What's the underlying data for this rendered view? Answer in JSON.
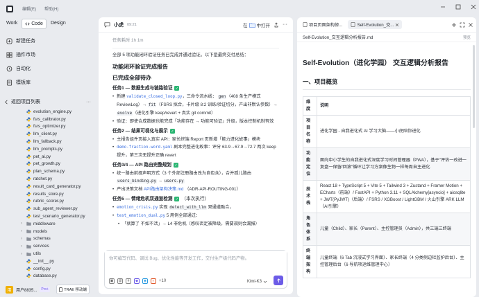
{
  "titlebar": {
    "menus": [
      "编辑(E)",
      "帮助(H)"
    ]
  },
  "sidebar": {
    "modes": [
      "Work",
      "Code",
      "Design"
    ],
    "nav": [
      {
        "label": "新建任务",
        "icon": "new-task-icon"
      },
      {
        "label": "插件市场",
        "icon": "plugin-market-icon"
      },
      {
        "label": "自动化",
        "icon": "automation-icon"
      },
      {
        "label": "模板库",
        "icon": "template-icon"
      }
    ],
    "back_label": "返回项目列表",
    "files": [
      {
        "name": "evolution_engine.py",
        "type": "file"
      },
      {
        "name": "fsrs_calibrator.py",
        "type": "file"
      },
      {
        "name": "fsrs_optimizer.py",
        "type": "file"
      },
      {
        "name": "llm_client.py",
        "type": "file"
      },
      {
        "name": "llm_fallback.py",
        "type": "file"
      },
      {
        "name": "llm_prompts.py",
        "type": "file"
      },
      {
        "name": "pet_ai.py",
        "type": "file"
      },
      {
        "name": "pet_growth.py",
        "type": "file"
      },
      {
        "name": "plan_schema.py",
        "type": "file"
      },
      {
        "name": "ratchet.py",
        "type": "file"
      },
      {
        "name": "result_card_generator.py",
        "type": "file"
      },
      {
        "name": "results_store.py",
        "type": "file"
      },
      {
        "name": "rubric_scorer.py",
        "type": "file"
      },
      {
        "name": "sub_agent_reviewer.py",
        "type": "file"
      },
      {
        "name": "test_scenario_generator.py",
        "type": "file"
      },
      {
        "name": "middleware",
        "type": "folder"
      },
      {
        "name": "models",
        "type": "folder"
      },
      {
        "name": "schemas",
        "type": "folder"
      },
      {
        "name": "services",
        "type": "folder"
      },
      {
        "name": "utils",
        "type": "folder"
      },
      {
        "name": "__init__.py",
        "type": "file"
      },
      {
        "name": "config.py",
        "type": "file"
      },
      {
        "name": "database.py",
        "type": "file"
      }
    ],
    "user": {
      "name": "用户8835...",
      "badge": "Pro+",
      "avatar": "用",
      "trae_label": "TRAE 移动端"
    }
  },
  "chat": {
    "title": "小虎",
    "time": "09:21",
    "branch_label": "在",
    "open_label": "中打开",
    "elapsed": "任务耗时 1h 1m",
    "intro": "全部 5 项功能闭环验证任务已完成并通过验证。以下是最终交付总结：",
    "h1": "功能闭环验证完成报告",
    "h1b": "已完成全部待办",
    "task1_title": "任务1 — 数据生成与链路验证",
    "task1_b1_pre": "新建",
    "task1_b1_code1": "validate_closed_loop.py",
    "task1_b1_mid": "，三命令流水线：",
    "task1_b1_code2": "gen",
    "task1_b1_mid2": "（408 条生产模式 ReviewLog）→",
    "task1_b1_code3": "fit",
    "task1_b1_mid3": "（FSRS 拟合，卡片级 8:2 训练/验证切分，产出非默认参数）→",
    "task1_b1_code4": "evolve",
    "task1_b1_post": "（进化引擎 keep/revert + 真实 git commit）",
    "task1_b2": "验证：即使合成数据也能完成「功能存在 → 功能可验证」升级，版本控制机制有效",
    "task2_title": "任务2 — 结果可视化与展示",
    "task2_b1": "主报告组件页接入真实 API：家长终端 Report 页新增「能力进化故事」模块",
    "task2_b2_code": "demo-fraction-word.yaml",
    "task2_b2_post": "剧本完整进化故事：评分 63.9→67.9→72.7 两次 keep 提升，第三次无提升正确 revert",
    "task3_title": "任务3/4 — API 路由完整规划",
    "task3_b1_pre": "统一路由前缀声明方式（3 个外部注册路由改为自包含），合并孤儿路由",
    "task3_b1_code1": "users_binding.py",
    "task3_b1_arrow": "→",
    "task3_b1_code2": "users.py",
    "task3_b2_pre": "产出决策文档",
    "task3_b2_link": "API路由架构决策.md",
    "task3_b2_post": "（ADR-API-ROUTING-001）",
    "task5_title": "任务5 — 情绪危机双通道检测",
    "task5_title_post": "（本次执行）",
    "task5_b1_code1": "emotion_crisis.py",
    "task5_b1_mid": "实现",
    "task5_b1_code2": "detect_with_llm",
    "task5_b1_post": "双通道融合，",
    "task5_b2_code": "test_emotion_dual.py",
    "task5_b2_post": "5 用例全部通过：",
    "task5_b3": "「就算了 不如不活」→ L4 非危机（感叹否定被降级，需要规则会漏报）",
    "composer_placeholder": "你可编写代码、调试 Bug、优化性能等开发工作，交付生产级代码产物。",
    "composer_count": "+10",
    "model": "Kimi-K3"
  },
  "doc": {
    "tabs": [
      {
        "label": "项目页面架构修..."
      },
      {
        "label": "Self-Evolution_交..."
      }
    ],
    "path": "Self-Evolution_交互逻辑分析报告.md",
    "mode_label": "预览",
    "h1": "Self-Evolution（进化学园） 交互逻辑分析报告",
    "h2": "一、项目概览",
    "table_headers": [
      "维度",
      "说明"
    ],
    "rows": [
      {
        "key": "项目名称",
        "value": "进化学园 - 自我进化式 AI 学习大脑——小虎陪你进化"
      },
      {
        "key": "功能定位",
        "value": "面向中小学生的自我进化式深度学习时间管理器（PWA），基于\"评估一改进一复盘一保留/回滚\"循环让学习方案像生物一样每周自主进化"
      },
      {
        "key": "技术栈",
        "value": "React 18 + TypeScript 5 + Vite 5 + Tailwind 3 + Zustand + Framer Motion + ECharts（前端）/ FastAPI + Python 3.11 + SQLAlchemy[asyncio] + aiosqlite + JWT(PyJWT)（后端）/ FSRS / XGBoost / LightGBM / 火山引擎 ARK LLM（AI引擎）"
      },
      {
        "key": "角色体系",
        "value": "儿童（Child）、家长（Parent）、主控管理员（Admin），共三端三终端"
      },
      {
        "key": "终端架构",
        "value": "儿童终端（6 Tab 沉浸式学习界面）、家长终端（4 分类侧边栏监护后台）、主控管理后台（6 导航项运维管理中心）"
      }
    ]
  }
}
